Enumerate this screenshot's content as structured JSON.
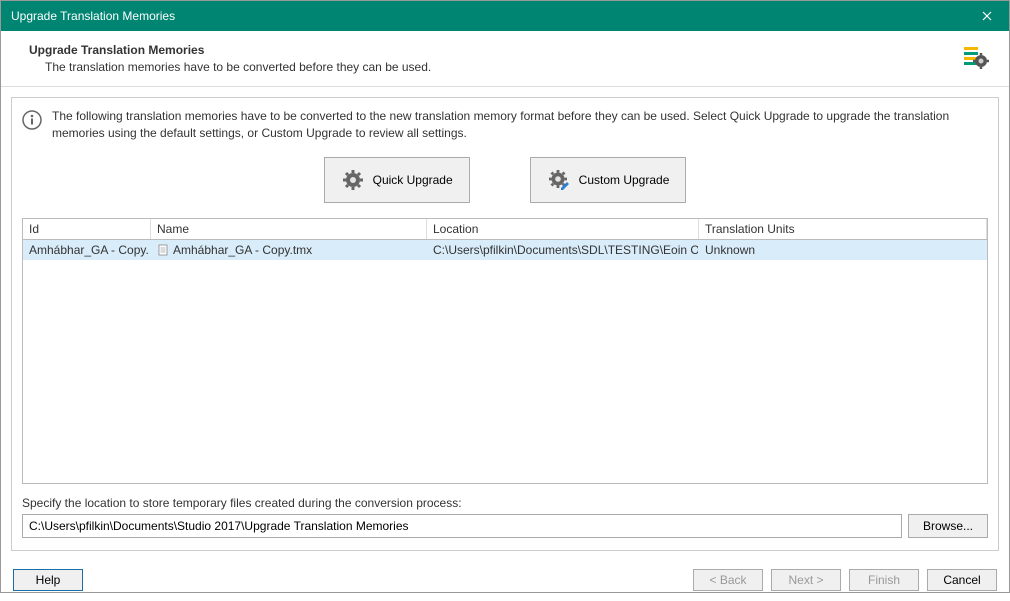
{
  "window": {
    "title": "Upgrade Translation Memories"
  },
  "header": {
    "title": "Upgrade Translation Memories",
    "subtitle": "The translation memories have to be converted before they can be used."
  },
  "info": {
    "text": "The following translation memories have to be converted to the new translation memory format before they can be used. Select Quick Upgrade to upgrade the translation memories using the default settings, or Custom Upgrade to review all settings."
  },
  "buttons": {
    "quick": "Quick Upgrade",
    "custom": "Custom Upgrade"
  },
  "table": {
    "columns": {
      "id": "Id",
      "name": "Name",
      "location": "Location",
      "units": "Translation Units"
    },
    "rows": [
      {
        "id": "Amhábhar_GA - Copy...",
        "name": "Amhábhar_GA - Copy.tmx",
        "location": "C:\\Users\\pfilkin\\Documents\\SDL\\TESTING\\Eoin  O...",
        "units": "Unknown"
      }
    ]
  },
  "locationSection": {
    "label": "Specify the location to store temporary files created during the conversion process:",
    "path": "C:\\Users\\pfilkin\\Documents\\Studio 2017\\Upgrade Translation Memories",
    "browse": "Browse..."
  },
  "footer": {
    "help": "Help",
    "back": "< Back",
    "next": "Next >",
    "finish": "Finish",
    "cancel": "Cancel"
  }
}
